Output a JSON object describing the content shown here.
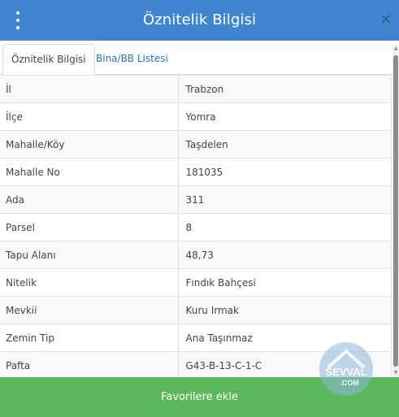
{
  "header": {
    "title": "Öznitelik Bilgisi",
    "close_symbol": "✕"
  },
  "tabs": [
    {
      "label": "Öznitelik Bilgisi",
      "active": true
    },
    {
      "label": "Bina/BB Listesi",
      "active": false
    }
  ],
  "attributes": [
    {
      "key": "İl",
      "value": "Trabzon"
    },
    {
      "key": "İlçe",
      "value": "Yomra"
    },
    {
      "key": "Mahalle/Köy",
      "value": "Taşdelen"
    },
    {
      "key": "Mahalle No",
      "value": "181035"
    },
    {
      "key": "Ada",
      "value": "311"
    },
    {
      "key": "Parsel",
      "value": "8"
    },
    {
      "key": "Tapu Alanı",
      "value": "48,73"
    },
    {
      "key": "Nitelik",
      "value": "Fındık Bahçesi"
    },
    {
      "key": "Mevkii",
      "value": "Kuru Irmak"
    },
    {
      "key": "Zemin Tip",
      "value": "Ana Taşınmaz"
    },
    {
      "key": "Pafta",
      "value": "G43-B-13-C-1-C"
    }
  ],
  "footer": {
    "button_label": "Favorilere ekle"
  },
  "watermark": {
    "text": "SEVVAL.COM"
  },
  "icons": {
    "menu": "vertical-dots-icon",
    "close": "close-icon"
  },
  "colors": {
    "header": "#3f86cf",
    "footer": "#5cb85c",
    "tab_link": "#2f73b5"
  }
}
